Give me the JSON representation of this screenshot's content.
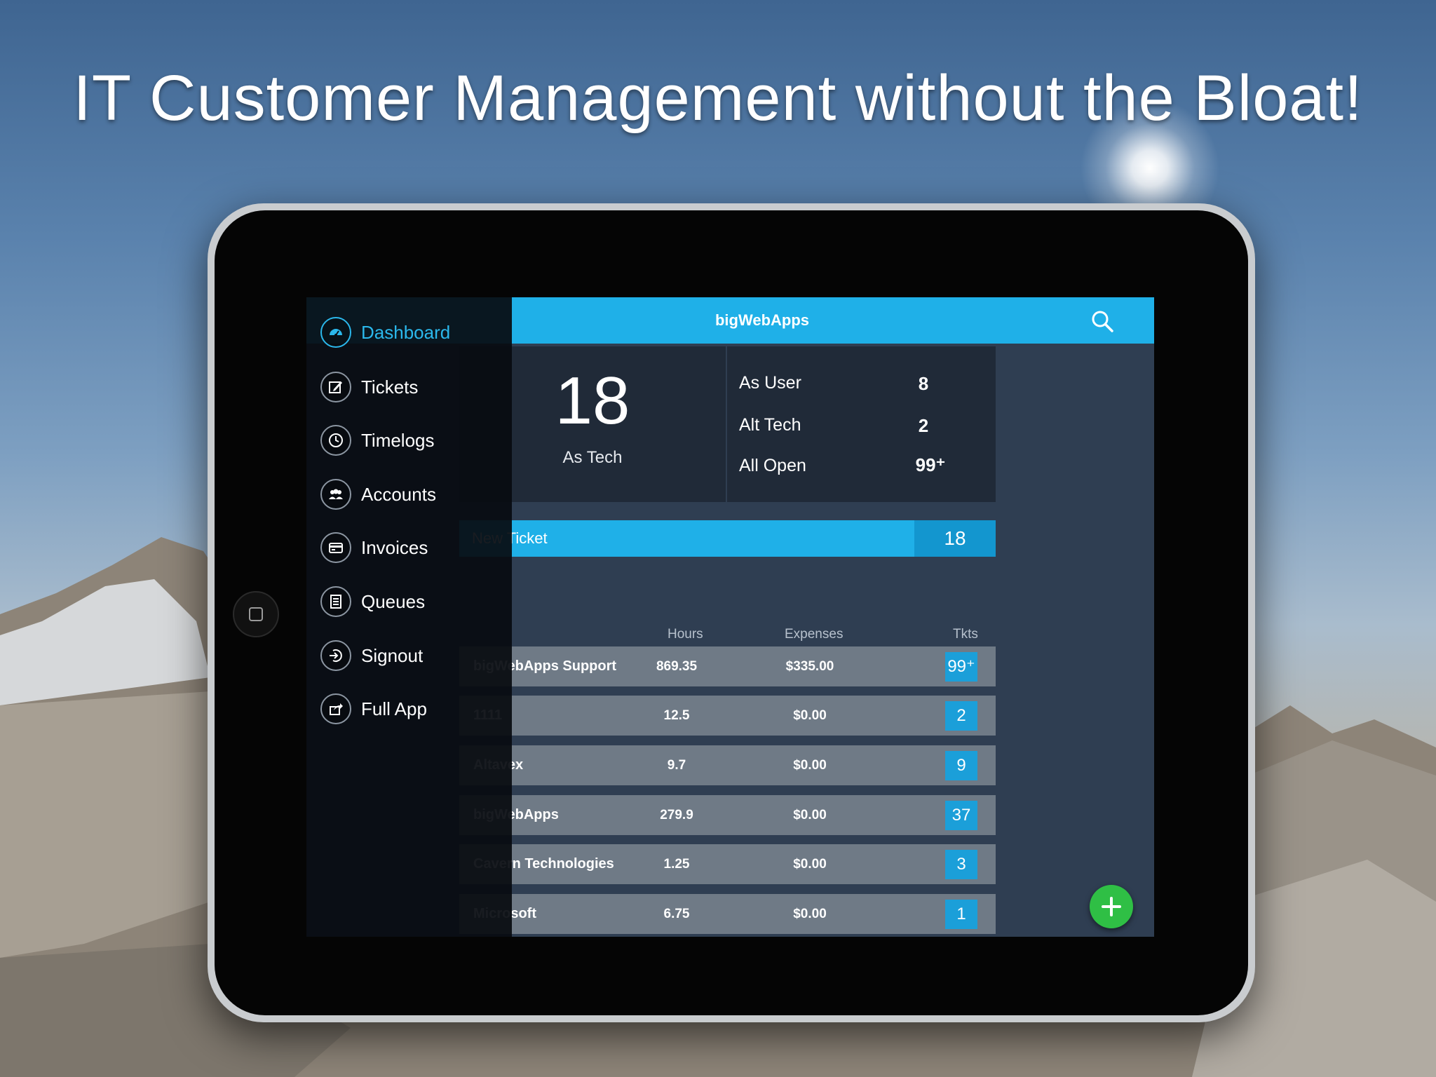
{
  "headline": "IT Customer Management without the Bloat!",
  "app": {
    "title": "bigWebApps",
    "accent_color": "#1fb0e8",
    "fab_color": "#2fbf45",
    "icons": {
      "search": "search-icon",
      "add": "plus-icon"
    }
  },
  "sidebar": {
    "items": [
      {
        "label": "Dashboard",
        "icon": "dashboard-icon",
        "active": true
      },
      {
        "label": "Tickets",
        "icon": "edit-icon"
      },
      {
        "label": "Timelogs",
        "icon": "clock-icon"
      },
      {
        "label": "Accounts",
        "icon": "people-icon"
      },
      {
        "label": "Invoices",
        "icon": "card-icon"
      },
      {
        "label": "Queues",
        "icon": "list-icon"
      },
      {
        "label": "Signout",
        "icon": "signout-icon"
      },
      {
        "label": "Full App",
        "icon": "share-icon"
      }
    ]
  },
  "dashboard": {
    "as_tech": {
      "count": "18",
      "label": "As Tech"
    },
    "stats": [
      {
        "label": "As User",
        "value": "8"
      },
      {
        "label": "Alt Tech",
        "value": "2"
      },
      {
        "label": "All Open",
        "value": "99⁺"
      }
    ],
    "new_ticket": {
      "label": "New Ticket",
      "count": "18"
    }
  },
  "accounts_table": {
    "headers": {
      "hours": "Hours",
      "expenses": "Expenses",
      "tkts": "Tkts"
    },
    "rows": [
      {
        "name": "bigWebApps Support",
        "hours": "869.35",
        "expenses": "$335.00",
        "tkts": "99⁺"
      },
      {
        "name": "1111",
        "hours": "12.5",
        "expenses": "$0.00",
        "tkts": "2"
      },
      {
        "name": "Altavex",
        "hours": "9.7",
        "expenses": "$0.00",
        "tkts": "9"
      },
      {
        "name": "bigWebApps",
        "hours": "279.9",
        "expenses": "$0.00",
        "tkts": "37"
      },
      {
        "name": "Cavern Technologies",
        "hours": "1.25",
        "expenses": "$0.00",
        "tkts": "3"
      },
      {
        "name": "Microsoft",
        "hours": "6.75",
        "expenses": "$0.00",
        "tkts": "1"
      }
    ]
  }
}
